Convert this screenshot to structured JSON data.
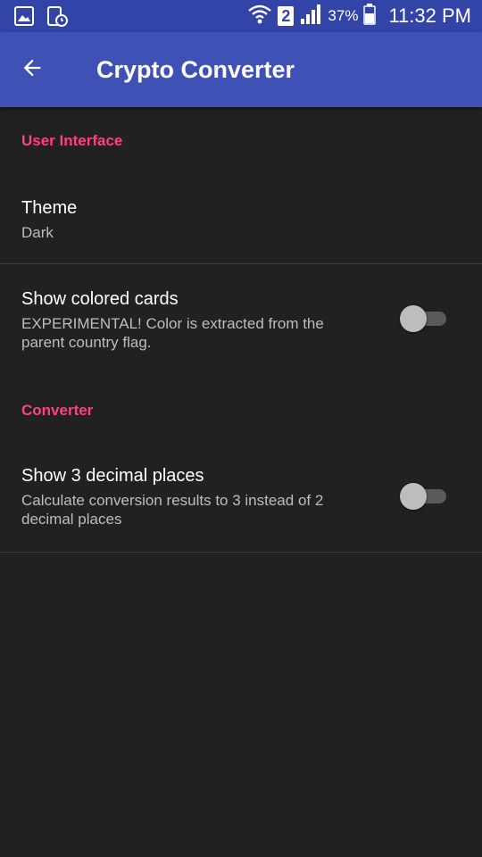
{
  "status_bar": {
    "battery": "37%",
    "time": "11:32 PM",
    "sim": "2",
    "icons": [
      "gallery-icon",
      "screenshot-icon",
      "wifi-icon",
      "sim-icon",
      "signal-icon",
      "battery-icon"
    ]
  },
  "app_bar": {
    "title": "Crypto Converter",
    "back_icon": "arrow-back-icon",
    "color": "#3f51b5"
  },
  "categories": {
    "ui": "User Interface",
    "converter": "Converter"
  },
  "prefs": {
    "theme": {
      "title": "Theme",
      "summary": "Dark"
    },
    "colored_cards": {
      "title": "Show colored cards",
      "summary": "EXPERIMENTAL! Color is extracted from the parent country flag.",
      "checked": false
    },
    "decimal_places": {
      "title": "Show 3 decimal places",
      "summary": "Calculate conversion results to 3 instead of 2 decimal places",
      "checked": false
    }
  },
  "colors": {
    "accent": "#ff4081",
    "background": "#212121",
    "primary": "#3f51b5"
  }
}
